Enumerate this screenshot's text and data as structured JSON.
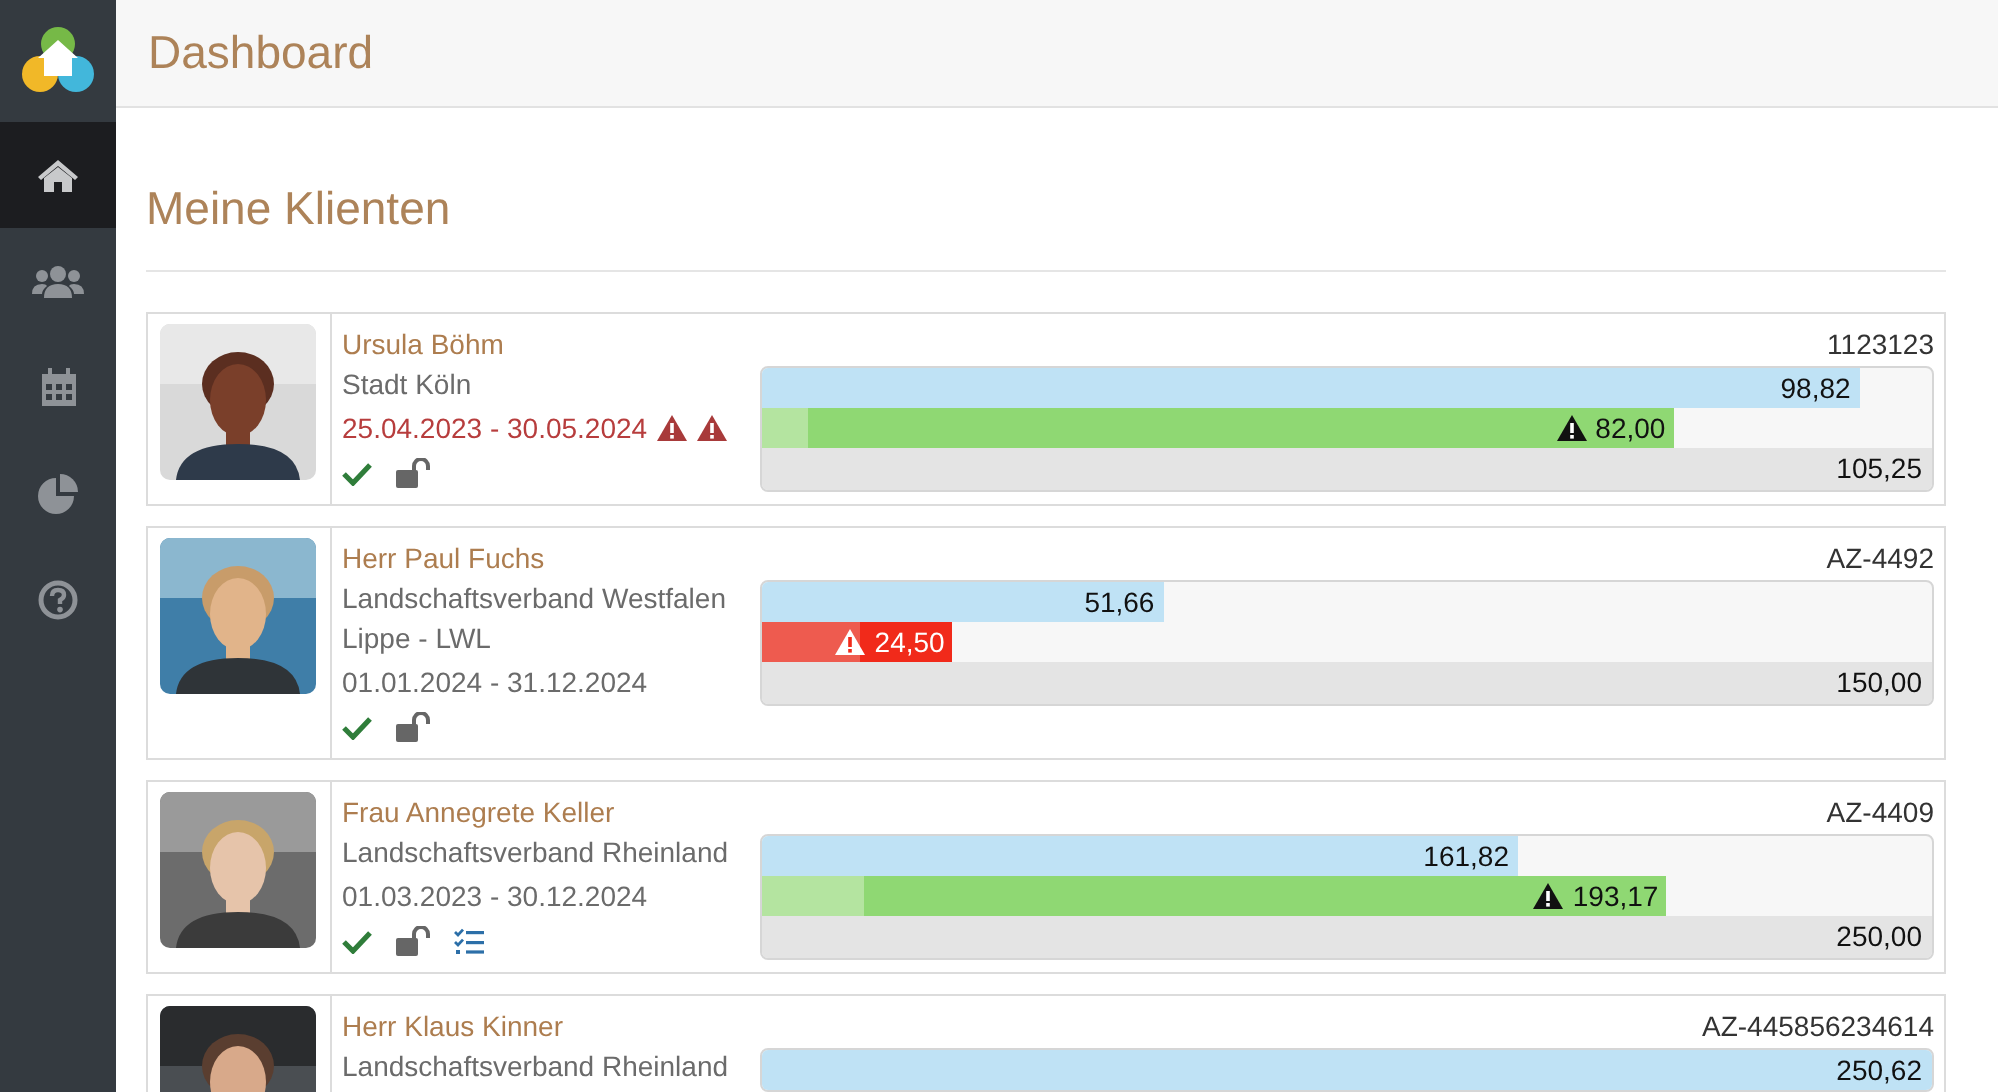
{
  "sidebar": {
    "items": [
      {
        "kind": "home",
        "selected": true
      },
      {
        "kind": "users",
        "selected": false
      },
      {
        "kind": "calendar",
        "selected": false
      },
      {
        "kind": "pie",
        "selected": false
      },
      {
        "kind": "help",
        "selected": false
      }
    ]
  },
  "header": {
    "title": "Dashboard"
  },
  "section": {
    "title": "Meine Klienten"
  },
  "clients": [
    {
      "name": "Ursula Böhm",
      "organization": "Stadt Köln",
      "period": "25.04.2023 - 30.05.2024",
      "period_overdue": true,
      "date_icons": [
        {
          "kind": "warning"
        },
        {
          "kind": "warning"
        }
      ],
      "approved": true,
      "locked": false,
      "has_checklist": false,
      "file_number": "1123123",
      "used": {
        "value": "98,82",
        "level": 0.939
      },
      "planned": {
        "value": "82,00",
        "level": 0.779,
        "critical": false,
        "warning": true,
        "prior": {
          "level": 0.039
        }
      },
      "total": {
        "value": "105,25"
      }
    },
    {
      "name": "Herr Paul Fuchs",
      "organization": "Landschaftsverband Westfalen Lippe - LWL",
      "period": "01.01.2024 - 31.12.2024",
      "period_overdue": false,
      "approved": true,
      "locked": false,
      "has_checklist": false,
      "file_number": "AZ-4492",
      "used": {
        "value": "51,66",
        "level": 0.344
      },
      "planned": {
        "value": "24,50",
        "level": 0.163,
        "critical": true,
        "warning": true,
        "prior": {
          "level": 0.083
        }
      },
      "total": {
        "value": "150,00"
      }
    },
    {
      "name": "Frau Annegrete Keller",
      "organization": "Landschaftsverband Rheinland",
      "period": "01.03.2023 - 30.12.2024",
      "period_overdue": false,
      "approved": true,
      "locked": false,
      "has_checklist": true,
      "file_number": "AZ-4409",
      "used": {
        "value": "161,82",
        "level": 0.647
      },
      "planned": {
        "value": "193,17",
        "level": 0.773,
        "critical": false,
        "warning": true,
        "prior": {
          "level": 0.088
        }
      },
      "total": {
        "value": "250,00"
      }
    },
    {
      "name": "Herr Klaus Kinner",
      "organization": "Landschaftsverband Rheinland",
      "file_number": "AZ-445856234614",
      "used": {
        "value": "250,62",
        "level": 1
      }
    }
  ]
}
